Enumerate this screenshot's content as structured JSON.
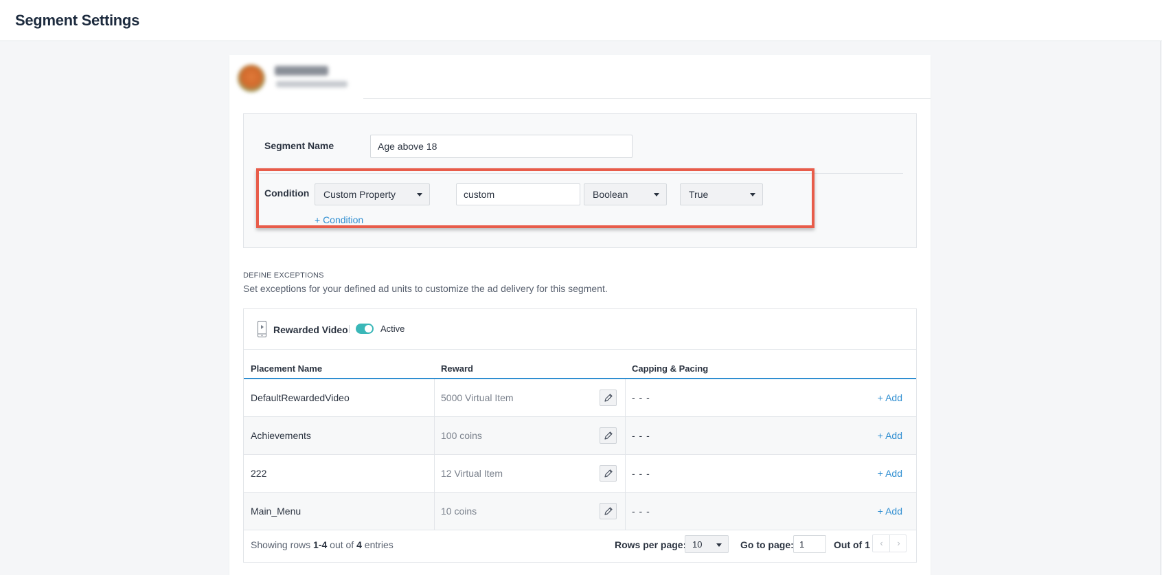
{
  "page": {
    "title": "Segment Settings"
  },
  "segment": {
    "name_label": "Segment Name",
    "name_value": "Age above 18",
    "condition_label": "Condition",
    "condition": {
      "property_type": "Custom Property",
      "property_name": "custom",
      "value_type": "Boolean",
      "value": "True"
    },
    "add_condition_label": "+ Condition"
  },
  "exceptions": {
    "title": "DEFINE EXCEPTIONS",
    "description": "Set exceptions for your defined ad units to customize the ad delivery for this segment."
  },
  "ad_unit": {
    "name": "Rewarded Video",
    "status_label": "Active",
    "active": true,
    "icon": "phone-icon"
  },
  "table": {
    "columns": [
      "Placement Name",
      "Reward",
      "Capping & Pacing"
    ],
    "rows": [
      {
        "placement": "DefaultRewardedVideo",
        "reward": "5000 Virtual Item",
        "capping": "- - -",
        "action": "+ Add"
      },
      {
        "placement": "Achievements",
        "reward": "100 coins",
        "capping": "- - -",
        "action": "+ Add"
      },
      {
        "placement": "222",
        "reward": "12 Virtual Item",
        "capping": "- - -",
        "action": "+ Add"
      },
      {
        "placement": "Main_Menu",
        "reward": "10 coins",
        "capping": "- - -",
        "action": "+ Add"
      }
    ]
  },
  "pagination": {
    "showing_prefix": "Showing rows",
    "range": "1-4",
    "outof_text": "out of",
    "total": "4",
    "entries_text": "entries",
    "rows_per_page_label": "Rows per page:",
    "rows_per_page_value": "10",
    "goto_label": "Go to page:",
    "goto_value": "1",
    "out_of_label": "Out of 1",
    "prev_glyph": "‹",
    "next_glyph": "›"
  },
  "colors": {
    "accent": "#2f8ed1",
    "highlight": "#e85c4a",
    "toggle_on": "#3ab7b8"
  }
}
